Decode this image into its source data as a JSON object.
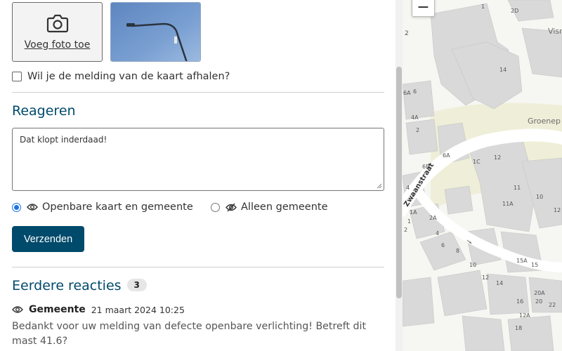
{
  "photo": {
    "add_label": "Voeg foto toe",
    "add_icon": "camera-icon"
  },
  "remove_from_map": {
    "label": "Wil je de melding van de kaart afhalen?",
    "checked": false
  },
  "respond": {
    "title": "Reageren",
    "textarea_value": "Dat klopt inderdaad!",
    "visibility_options": [
      {
        "label": "Openbare kaart en gemeente",
        "icon": "eye-icon",
        "selected": true
      },
      {
        "label": "Alleen gemeente",
        "icon": "eye-off-icon",
        "selected": false
      }
    ],
    "submit_label": "Verzenden"
  },
  "previous": {
    "title": "Eerdere reacties",
    "count": "3",
    "comments": [
      {
        "visibility_icon": "eye-icon",
        "author": "Gemeente",
        "date": "21 maart 2024 10:25",
        "text": "Bedankt voor uw melding van defecte openbare verlichting! Betreft dit mast 41.6?"
      }
    ]
  },
  "map": {
    "zoom_out_label": "−",
    "street_labels": [
      "Zwaanstraat",
      "Groenep",
      "Visr"
    ],
    "house_numbers": [
      "1",
      "2D",
      "2",
      "14",
      "6A",
      "6",
      "4A",
      "2",
      "6A",
      "6B",
      "1C",
      "12",
      "4",
      "2",
      "11",
      "10",
      "1A",
      "11A",
      "1",
      "2A",
      "4",
      "12",
      "2",
      "6",
      "8",
      "15A",
      "15",
      "10",
      "12",
      "14",
      "16",
      "20A",
      "20",
      "22",
      "12A",
      "18"
    ]
  },
  "colors": {
    "brand": "#004a6b",
    "radio_selected": "#1a73e8",
    "map_background": "#f6f6f2",
    "map_building": "#d9d9d9",
    "map_road": "#ffffff",
    "map_plaza": "#efefd9"
  }
}
